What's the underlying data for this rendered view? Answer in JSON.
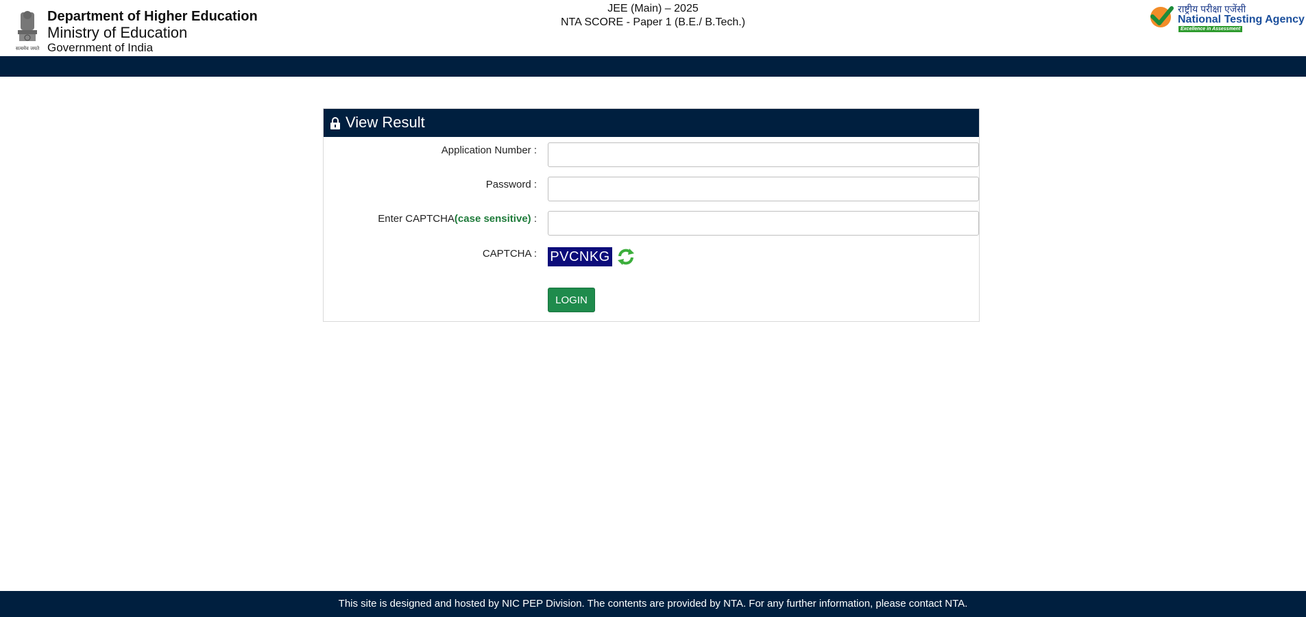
{
  "header": {
    "department": "Department of Higher Education",
    "ministry": "Ministry of Education",
    "government": "Government of India",
    "emblem_motto": "सत्यमेव जयते",
    "exam_title": "JEE (Main) – 2025",
    "exam_subtitle": "NTA SCORE - Paper 1 (B.E./ B.Tech.)",
    "nta_hindi": "राष्ट्रीय परीक्षा एजेंसी",
    "nta_name": "National Testing Agency",
    "nta_tagline": "Excellence in Assessment"
  },
  "panel": {
    "title": "View Result",
    "application_label": "Application Number :",
    "application_value": "",
    "password_label": "Password :",
    "password_value": "",
    "captcha_input_label": "Enter CAPTCHA",
    "captcha_case_note": "(case sensitive)",
    "captcha_input_suffix": " :",
    "captcha_input_value": "",
    "captcha_label": "CAPTCHA :",
    "captcha_code": "PVCNKG",
    "login_label": "LOGIN"
  },
  "footer": {
    "text": "This site is designed and hosted by NIC PEP Division. The contents are provided by NTA. For any further information, please contact NTA."
  },
  "colors": {
    "navy": "#001f3f",
    "login_green": "#1f8b4c",
    "captcha_bg": "#0c0c7a",
    "case_note_green": "#1e7b3a"
  },
  "icons": {
    "emblem": "emblem-icon",
    "lock": "lock-icon",
    "refresh": "refresh-icon",
    "nta_logo": "nta-logo-icon"
  }
}
